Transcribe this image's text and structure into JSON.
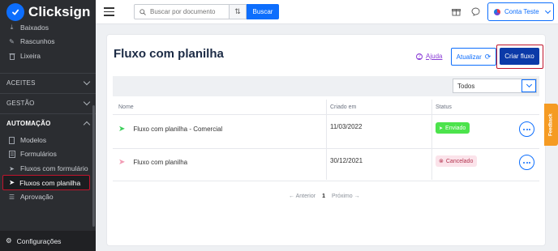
{
  "brand": {
    "name": "Clicksign"
  },
  "sidebar": {
    "items_top": [
      {
        "label": "Baixados",
        "icon": "download-icon"
      },
      {
        "label": "Rascunhos",
        "icon": "pencil-icon"
      },
      {
        "label": "Lixeira",
        "icon": "trash-icon"
      }
    ],
    "sections": [
      {
        "label": "ACEITES",
        "expanded": false
      },
      {
        "label": "GESTÃO",
        "expanded": false
      },
      {
        "label": "AUTOMAÇÃO",
        "expanded": true
      }
    ],
    "automacao_items": [
      {
        "label": "Modelos",
        "icon": "document-icon"
      },
      {
        "label": "Formulários",
        "icon": "form-icon"
      },
      {
        "label": "Fluxos com formulário",
        "icon": "send-icon"
      },
      {
        "label": "Fluxos com planilha",
        "icon": "send-icon",
        "active": true
      },
      {
        "label": "Aprovação",
        "icon": "list-icon"
      }
    ],
    "footer": {
      "label": "Configurações",
      "icon": "gear-icon"
    }
  },
  "topbar": {
    "search_placeholder": "Buscar por documento",
    "search_button": "Buscar",
    "account_label": "Conta Teste"
  },
  "page": {
    "title": "Fluxo com planilha",
    "help_label": "Ajuda",
    "update_label": "Atualizar",
    "create_label": "Criar fluxo",
    "filter_selected": "Todos"
  },
  "table": {
    "headers": {
      "name": "Nome",
      "created": "Criado em",
      "status": "Status"
    },
    "rows": [
      {
        "name": "Fluxo com planilha - Comercial",
        "created": "11/03/2022",
        "status": "Enviado",
        "status_color": "#4ce34c"
      },
      {
        "name": "Fluxo com planilha",
        "created": "30/12/2021",
        "status": "Cancelado",
        "status_color": "#fbe3ea"
      }
    ]
  },
  "pagination": {
    "prev": "Anterior",
    "current": "1",
    "next": "Próximo"
  },
  "feedback": {
    "label": "Feedback"
  },
  "colors": {
    "accent": "#0d6efd",
    "primary_dark": "#0b3aa8",
    "highlight": "#c0142c",
    "sidebar_bg": "#2b2d31"
  }
}
